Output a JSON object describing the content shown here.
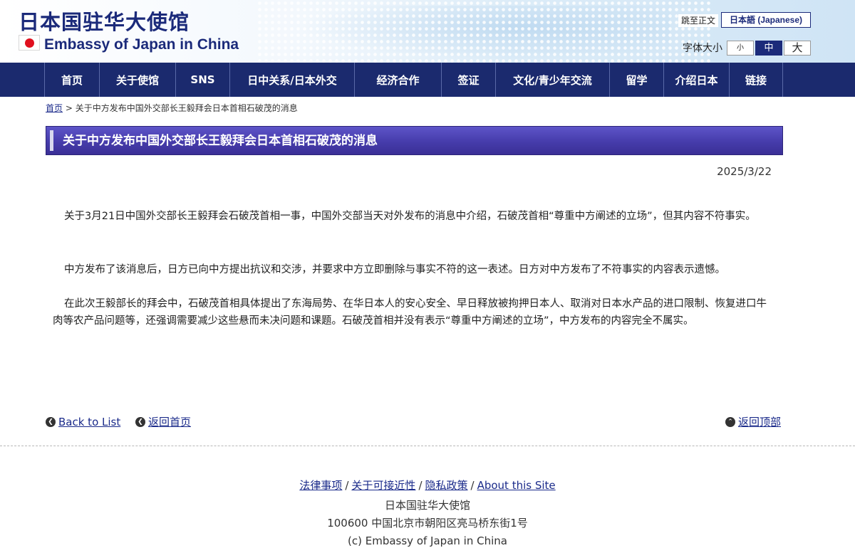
{
  "header": {
    "title_cn": "日本国驻华大使馆",
    "title_en": "Embassy of Japan in China",
    "skip_link": "跳至正文",
    "language_button": "日本語 (Japanese)",
    "font_size_label": "字体大小",
    "font_sizes": [
      "小",
      "中",
      "大"
    ],
    "font_size_selected": "中"
  },
  "nav": {
    "items": [
      "首页",
      "关于使馆",
      "SNS",
      "日中关系/日本外交",
      "经济合作",
      "签证",
      "文化/青少年交流",
      "留学",
      "介绍日本",
      "链接"
    ]
  },
  "breadcrumb": {
    "home": "首页",
    "separator": ">",
    "current": "关于中方发布中国外交部长王毅拜会日本首相石破茂的消息"
  },
  "article": {
    "title": "关于中方发布中国外交部长王毅拜会日本首相石破茂的消息",
    "date": "2025/3/22",
    "paragraphs": [
      "关于3月21日中国外交部长王毅拜会石破茂首相一事，中国外交部当天对外发布的消息中介绍，石破茂首相“尊重中方阐述的立场”，但其内容不符事实。",
      "中方发布了该消息后，日方已向中方提出抗议和交涉，并要求中方立即删除与事实不符的这一表述。日方对中方发布了不符事实的内容表示遗憾。",
      "在此次王毅部长的拜会中，石破茂首相具体提出了东海局势、在华日本人的安心安全、早日释放被拘押日本人、取消对日本水产品的进口限制、恢复进口牛肉等农产品问题等，还强调需要减少这些悬而未决问题和课题。石破茂首相并没有表示“尊重中方阐述的立场”，中方发布的内容完全不属实。"
    ]
  },
  "bottom_links": {
    "back_to_list": "Back to List",
    "back_home": "返回首页",
    "back_top": "返回顶部"
  },
  "footer": {
    "links": [
      "法律事项",
      "关于可接近性",
      "隐私政策",
      "About this Site"
    ],
    "separator": "/",
    "org": "日本国驻华大使馆",
    "address": "100600 中国北京市朝阳区亮马桥东街1号",
    "copyright": "(c) Embassy of Japan in China"
  },
  "colors": {
    "nav_bg": "#1b2a6e",
    "title_bar": "#463cab",
    "link": "#1a2a8a",
    "flag_red": "#e0101e"
  },
  "icons": {
    "flag": "japan-flag-icon",
    "back": "circle-chevron-left-icon",
    "top": "circle-chevron-up-icon"
  }
}
